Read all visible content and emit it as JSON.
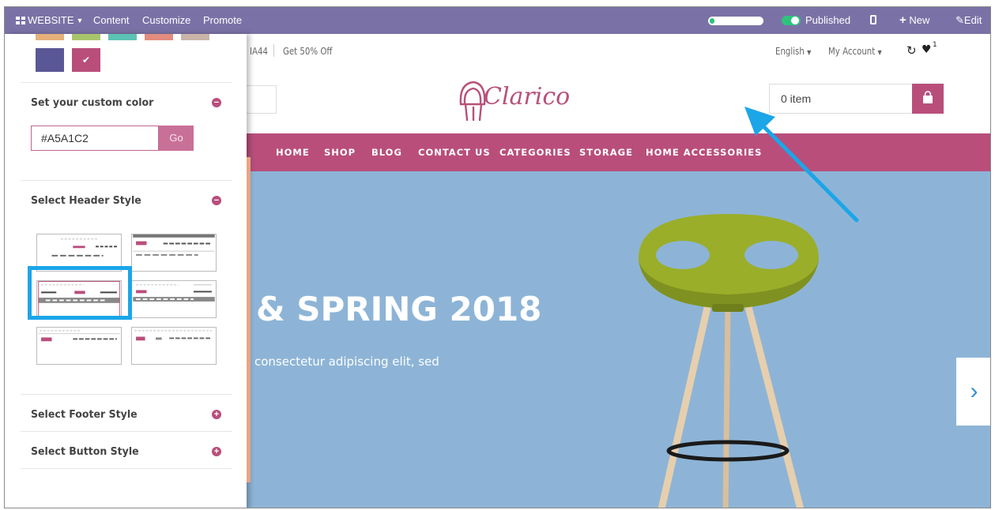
{
  "topbar": {
    "website_label": "WEBSITE",
    "content_label": "Content",
    "customize_label": "Customize",
    "promote_label": "Promote",
    "published_label": "Published",
    "new_label": "New",
    "edit_label": "Edit"
  },
  "site": {
    "promo_code": "IA44",
    "promo_text": "Get 50% Off",
    "language": "English",
    "account": "My Account",
    "wishlist_count": "1",
    "logo_text": "Clarico",
    "cart_text": "0 item",
    "nav": [
      "HOME",
      "SHOP",
      "BLOG",
      "CONTACT US",
      "CATEGORIES",
      "STORAGE",
      "HOME ACCESSORIES"
    ],
    "hero_title": "& SPRING 2018",
    "hero_subtitle": "consectetur adipiscing elit, sed"
  },
  "panel": {
    "swatch_colors": [
      "#e6b07a",
      "#a8c56c",
      "#5cc2b4",
      "#e28b7f",
      "#c9b4a8",
      "#5a5797",
      "#b94e7b"
    ],
    "custom_color_title": "Set your custom color",
    "custom_color_value": "#A5A1C2",
    "go_label": "Go",
    "header_style_title": "Select Header Style",
    "footer_style_title": "Select Footer Style",
    "button_style_title": "Select Button Style"
  },
  "colors": {
    "admin_bar": "#7a72a6",
    "accent": "#b94e7b",
    "hero_bg": "#8db4d6",
    "annotation": "#1ba6e8"
  }
}
